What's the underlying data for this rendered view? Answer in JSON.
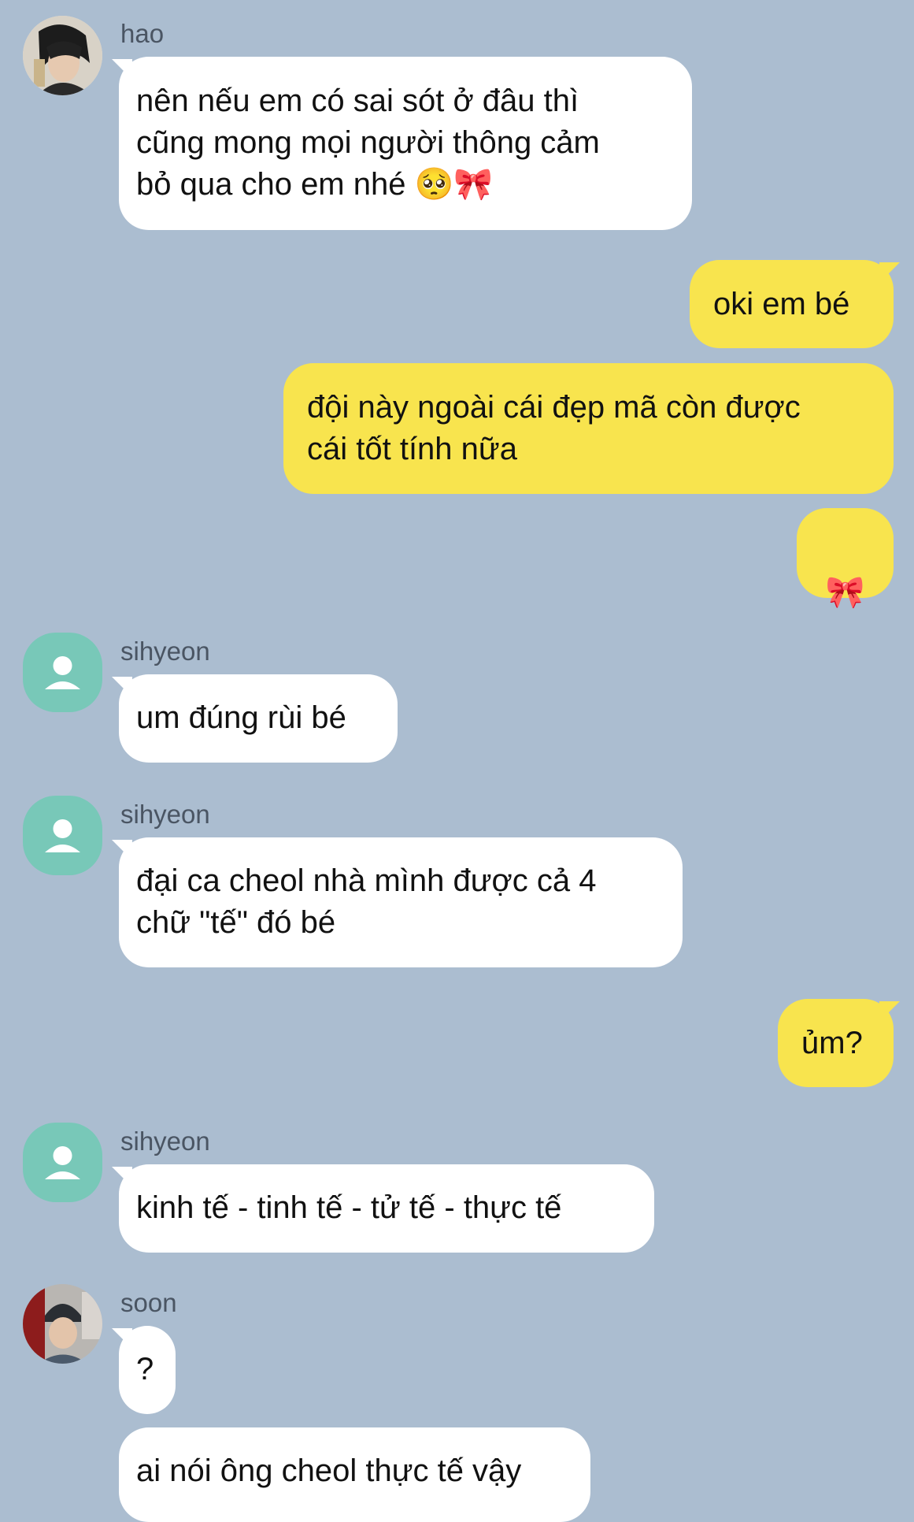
{
  "messages": [
    {
      "sender": "hao",
      "text": "nên nếu em có sai sót ở đâu thì\ncũng mong mọi người thông cảm\nbỏ qua cho em nhé 🥺🎀"
    },
    {
      "sender": "me",
      "text": "oki em bé"
    },
    {
      "sender": "me",
      "text": "đội này ngoài cái đẹp mã còn được\ncái tốt tính nữa"
    },
    {
      "sender": "me",
      "text": "🎀"
    },
    {
      "sender": "sihyeon",
      "text": "um đúng rùi bé"
    },
    {
      "sender": "sihyeon",
      "text": "đại ca cheol nhà mình được cả 4\nchữ \"tế\" đó bé"
    },
    {
      "sender": "me",
      "text": "ủm?"
    },
    {
      "sender": "sihyeon",
      "text": "kinh tế - tinh tế - tử tế - thực tế"
    },
    {
      "sender": "soon",
      "text": "?"
    },
    {
      "sender": "soon",
      "text": "ai nói ông cheol thực tế vậy"
    }
  ],
  "colors": {
    "background": "#abbdd0",
    "incoming_bubble": "#ffffff",
    "outgoing_bubble": "#f8e44e",
    "default_avatar": "#78c8b8"
  },
  "icons": {
    "default_avatar": "person-silhouette-icon"
  }
}
